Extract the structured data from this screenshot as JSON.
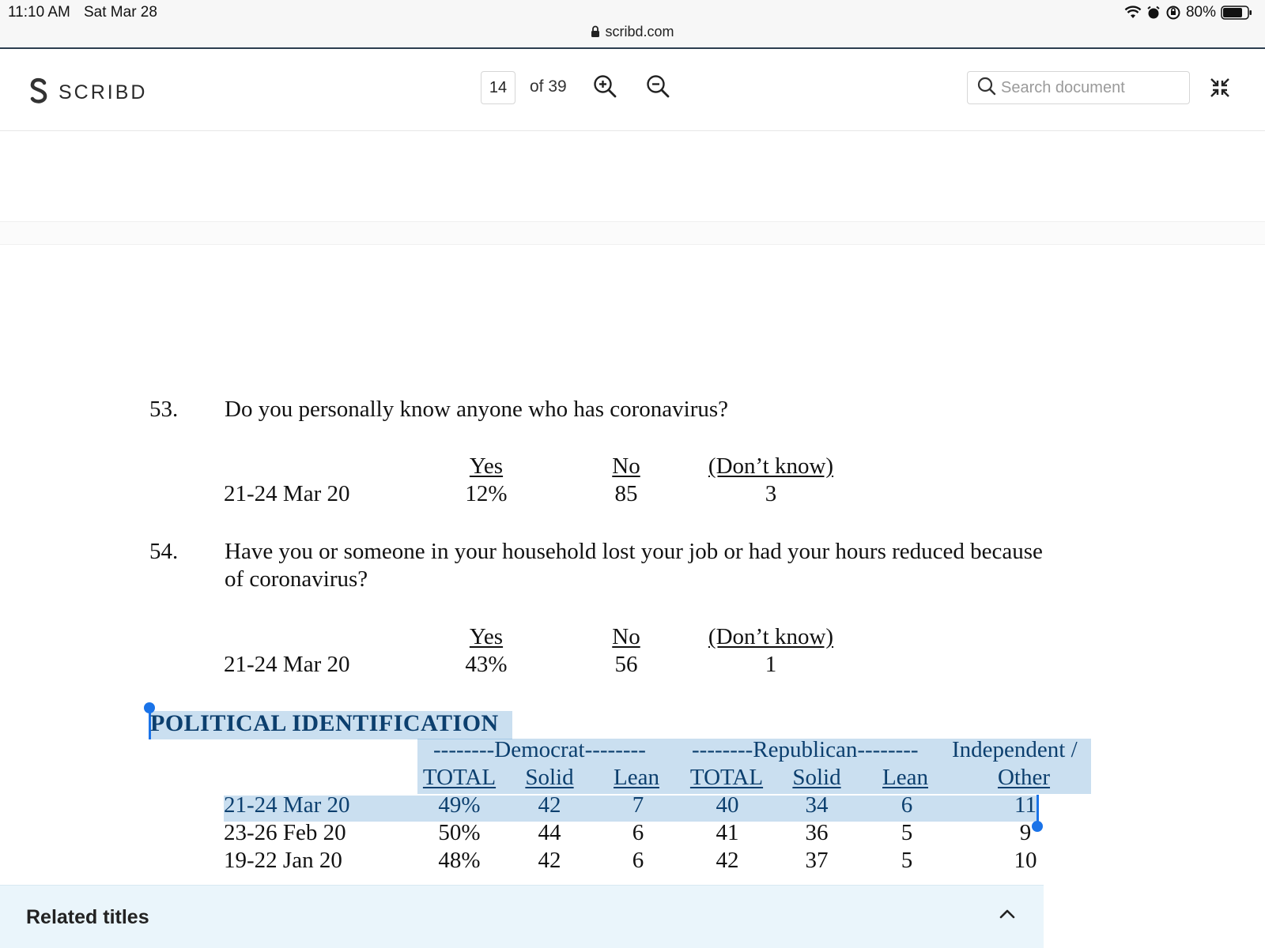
{
  "status_bar": {
    "time": "11:10 AM",
    "date": "Sat Mar 28",
    "battery": "80%",
    "battery_level": 0.8,
    "url": "scribd.com"
  },
  "toolbar": {
    "logo_text": "SCRIBD",
    "current_page": "14",
    "page_of": "of 39",
    "search_placeholder": "Search document"
  },
  "document": {
    "q53": {
      "number": "53.",
      "question": "Do you personally know anyone who has coronavirus?",
      "headers": [
        "Yes",
        "No",
        "(Don’t know)"
      ],
      "row": {
        "date": "21-24 Mar 20",
        "values": [
          "12%",
          "85",
          "3"
        ]
      }
    },
    "q54": {
      "number": "54.",
      "question_line1": "Have you or someone in your household lost your job or had your hours reduced because",
      "question_line2": "of coronavirus?",
      "headers": [
        "Yes",
        "No",
        "(Don’t know)"
      ],
      "row": {
        "date": "21-24 Mar 20",
        "values": [
          "43%",
          "56",
          "1"
        ]
      }
    },
    "political": {
      "title": "POLITICAL IDENTIFICATION",
      "group_democrat": "--------Democrat--------",
      "group_republican": "--------Republican--------",
      "group_independent": "Independent /",
      "columns": [
        "TOTAL",
        "Solid",
        "Lean",
        "TOTAL",
        "Solid",
        "Lean",
        "Other"
      ],
      "rows": [
        {
          "date": "21-24 Mar 20",
          "values": [
            "49%",
            "42",
            "7",
            "40",
            "34",
            "6",
            "11"
          ]
        },
        {
          "date": "23-26 Feb 20",
          "values": [
            "50%",
            "44",
            "6",
            "41",
            "36",
            "5",
            "9"
          ]
        },
        {
          "date": "19-22 Jan 20",
          "values": [
            "48%",
            "42",
            "6",
            "42",
            "37",
            "5",
            "10"
          ]
        }
      ]
    }
  },
  "related": {
    "title": "Related titles"
  }
}
